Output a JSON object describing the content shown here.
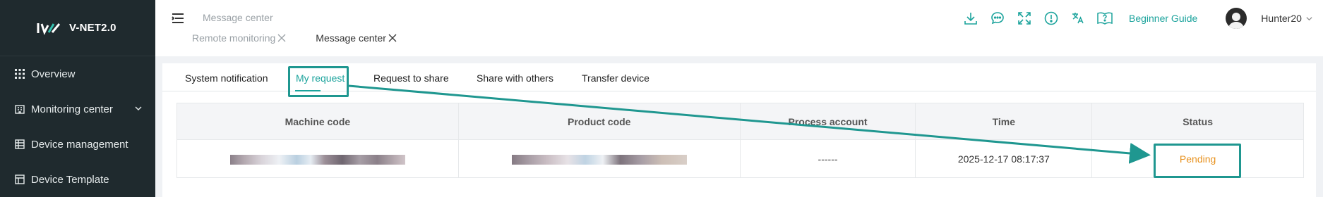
{
  "app": {
    "logo_text": "V-NET2.0"
  },
  "sidebar": {
    "items": [
      {
        "label": "Overview",
        "icon": "grid-icon"
      },
      {
        "label": "Monitoring center",
        "icon": "building-icon",
        "has_children": true
      },
      {
        "label": "Device management",
        "icon": "list-icon"
      },
      {
        "label": "Device Template",
        "icon": "template-icon"
      }
    ]
  },
  "header": {
    "breadcrumb": "Message center",
    "page_tabs": [
      {
        "label": "Remote monitoring",
        "active": false
      },
      {
        "label": "Message center",
        "active": true
      }
    ],
    "tools": [
      "download-icon",
      "chat-icon",
      "fullscreen-icon",
      "info-icon",
      "translate-icon",
      "help-book-icon"
    ],
    "guide_label": "Beginner Guide",
    "username": "Hunter20"
  },
  "subtabs": [
    {
      "label": "System notification",
      "active": false
    },
    {
      "label": "My request",
      "active": true
    },
    {
      "label": "Request to share",
      "active": false
    },
    {
      "label": "Share with others",
      "active": false
    },
    {
      "label": "Transfer device",
      "active": false
    }
  ],
  "table": {
    "columns": [
      "Machine code",
      "Product code",
      "Process account",
      "Time",
      "Status"
    ],
    "rows": [
      {
        "machine_code": "",
        "product_code": "",
        "process_account": "------",
        "time": "2025-12-17 08:17:37",
        "status": "Pending"
      }
    ]
  },
  "colors": {
    "accent": "#1ba39c",
    "sidebar_bg": "#1f2a2e",
    "pending": "#e8921f",
    "annotation": "#1f9790"
  }
}
